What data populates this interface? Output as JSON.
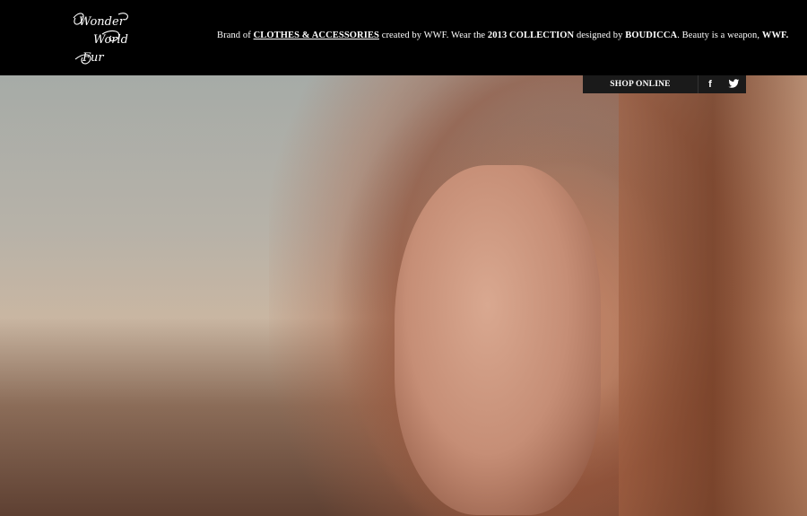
{
  "brand": {
    "logo_lines": [
      "Wonder",
      "World",
      "Fur"
    ]
  },
  "tagline": {
    "t1": "Brand of ",
    "link": "CLOTHES & ACCESSORIES",
    "t2": " created by WWF. Wear the ",
    "bold1": "2013 COLLECTION",
    "t3": " designed by ",
    "bold2": "BOUDICCA",
    "t4": ". Beauty is a weapon, ",
    "bold3": "WWF."
  },
  "nav": {
    "shop_online": "SHOP ONLINE",
    "facebook": "f",
    "twitter_icon": "twitter-bird-icon"
  },
  "colors": {
    "header_bg": "#000000",
    "bar_bg": "#1a1a1a",
    "text": "#ffffff"
  }
}
